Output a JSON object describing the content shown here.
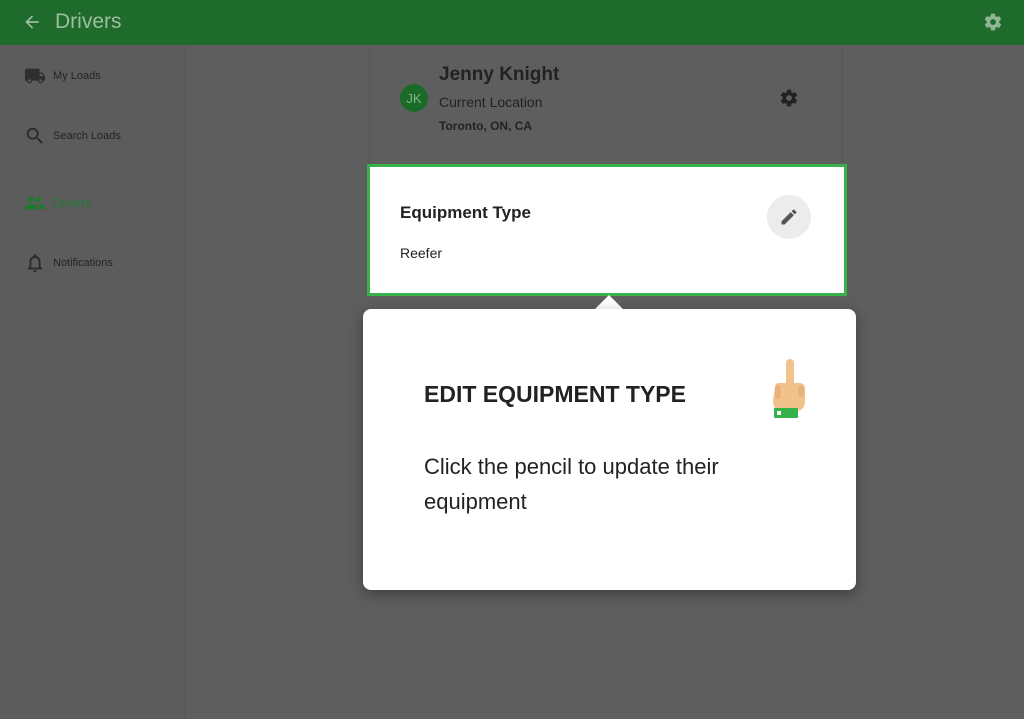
{
  "header": {
    "title": "Drivers",
    "back_icon": "arrow-left-icon",
    "settings_icon": "gear-icon"
  },
  "sidebar": {
    "items": [
      {
        "label": "My Loads",
        "icon": "truck-icon",
        "active": false
      },
      {
        "label": "Search Loads",
        "icon": "search-icon",
        "active": false
      },
      {
        "label": "Drivers",
        "icon": "people-icon",
        "active": true
      },
      {
        "label": "Notifications",
        "icon": "bell-icon",
        "active": false
      }
    ]
  },
  "driver": {
    "initials": "JK",
    "name": "Jenny Knight",
    "location_label": "Current Location",
    "location": "Toronto, ON, CA"
  },
  "equipment": {
    "title": "Equipment Type",
    "value": "Reefer",
    "edit_icon": "pencil-icon"
  },
  "tooltip": {
    "title": "EDIT EQUIPMENT TYPE",
    "body": "Click the pencil to update their equipment",
    "icon": "pointing-hand-icon"
  },
  "colors": {
    "header": "#1f6b2c",
    "accent": "#38b14a",
    "active_nav": "#1d7a2e"
  }
}
